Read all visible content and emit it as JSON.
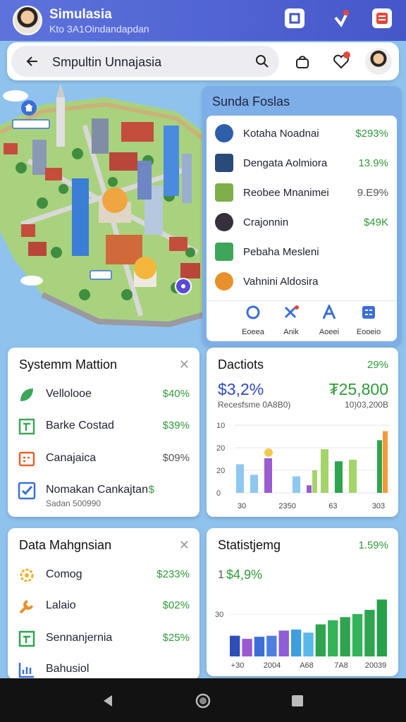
{
  "header": {
    "app_title": "Simulasia",
    "app_subtitle": "Kto 3A1Oindandapdan"
  },
  "search": {
    "query": "Smpultin Unnajasia"
  },
  "sunda_panel": {
    "title": "Sunda Foslas",
    "items": [
      {
        "label": "Kotaha Noadnai",
        "value": "$293%"
      },
      {
        "label": "Dengata Aolmiora",
        "value": "13.9%"
      },
      {
        "label": "Reobee Mnanimei",
        "value": "9.E9%"
      },
      {
        "label": "Crajonnin",
        "value": "$49K"
      },
      {
        "label": "Pebaha Mesleni",
        "value": ""
      },
      {
        "label": "Vahnini Aldosira",
        "value": ""
      }
    ],
    "tabs": [
      "Eoeea",
      "Anik",
      "Aoeei",
      "Eooeio"
    ]
  },
  "system_card": {
    "title": "Systemm Mattion",
    "items": [
      {
        "label": "Vellolooe",
        "value": "$40%"
      },
      {
        "label": "Barke Costad",
        "value": "$39%"
      },
      {
        "label": "Canajaica",
        "value": "$09%"
      },
      {
        "label": "Nomakan Cankajtan",
        "value": "$",
        "sub": "Sadan 500990"
      }
    ]
  },
  "dactiots_card": {
    "title": "Dactiots",
    "percent": "29%",
    "big_left": "$3,2%",
    "big_right": "₮25,800",
    "sub_left": "Recesfsme 0A8B0)",
    "sub_right": "10)03,200B"
  },
  "data_card": {
    "title": "Data Mahgnsian",
    "items": [
      {
        "label": "Comog",
        "value": "$233%"
      },
      {
        "label": "Lalaio",
        "value": "$02%"
      },
      {
        "label": "Sennanjernia",
        "value": "$25%"
      },
      {
        "label": "Bahusiol",
        "value": ""
      }
    ]
  },
  "stat_card": {
    "title": "Statistjemg",
    "percent": "1.59%",
    "big": "$4,9%",
    "big_prefix": "1"
  },
  "chart_data": [
    {
      "type": "bar",
      "title": "Dactiots",
      "yticks": [
        "10",
        "20",
        "20",
        "0"
      ],
      "xticks": [
        "30",
        "2350",
        "63",
        "303"
      ],
      "series": [
        {
          "color": "#8ec8f0",
          "values": [
            38,
            24,
            0,
            0,
            22,
            0,
            0,
            0,
            0,
            0,
            0
          ]
        },
        {
          "color": "#9a5cd0",
          "values": [
            0,
            0,
            46,
            0,
            0,
            10,
            0,
            0,
            0,
            0,
            0
          ]
        },
        {
          "color": "#f2c94c",
          "values": [
            0,
            0,
            0,
            0,
            0,
            0,
            0,
            0,
            0,
            0,
            0
          ]
        },
        {
          "color": "#a5d46a",
          "values": [
            0,
            0,
            0,
            0,
            0,
            30,
            58,
            0,
            44,
            0,
            0
          ]
        },
        {
          "color": "#2fa44f",
          "values": [
            0,
            0,
            0,
            0,
            0,
            0,
            0,
            42,
            0,
            0,
            70
          ]
        },
        {
          "color": "#f29a3a",
          "values": [
            0,
            0,
            0,
            0,
            0,
            0,
            0,
            0,
            0,
            0,
            82
          ]
        }
      ]
    },
    {
      "type": "bar",
      "title": "Statistjemg",
      "yticks": [
        "30"
      ],
      "xticks": [
        "+30",
        "2004",
        "A68",
        "7A8",
        "20039"
      ],
      "values": [
        40,
        34,
        38,
        40,
        50,
        52,
        46,
        62,
        70,
        76,
        82,
        90,
        110
      ],
      "colors": [
        "#2e4fb8",
        "#9b59d0",
        "#3b6fd6",
        "#4f7fe0",
        "#8d5fd8",
        "#3f9ee0",
        "#59b8e8",
        "#2fa44f",
        "#34b457",
        "#2fa44f",
        "#33b45a",
        "#2fa44f",
        "#27a04a"
      ]
    }
  ]
}
